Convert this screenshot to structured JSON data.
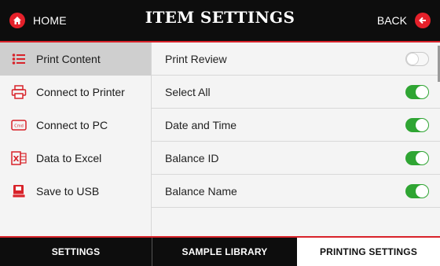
{
  "header": {
    "home_label": "HOME",
    "title": "ITEM SETTINGS",
    "back_label": "BACK"
  },
  "sidebar": {
    "items": [
      {
        "label": "Print Content",
        "icon": "list-icon",
        "active": true
      },
      {
        "label": "Connect to Printer",
        "icon": "printer-icon",
        "active": false
      },
      {
        "label": "Connect to PC",
        "icon": "cmd-icon",
        "active": false
      },
      {
        "label": "Data to Excel",
        "icon": "excel-icon",
        "active": false
      },
      {
        "label": "Save to USB",
        "icon": "usb-save-icon",
        "active": false
      }
    ]
  },
  "settings": {
    "rows": [
      {
        "label": "Print Review",
        "on": false
      },
      {
        "label": "Select All",
        "on": true
      },
      {
        "label": "Date and Time",
        "on": true
      },
      {
        "label": "Balance ID",
        "on": true
      },
      {
        "label": "Balance Name",
        "on": true
      }
    ]
  },
  "tabs": [
    {
      "label": "SETTINGS",
      "active": false
    },
    {
      "label": "SAMPLE LIBRARY",
      "active": false
    },
    {
      "label": "PRINTING SETTINGS",
      "active": true
    }
  ],
  "colors": {
    "accent_red": "#e4202a",
    "toggle_on": "#2fa533",
    "bar_dark": "#0d0d0d"
  }
}
